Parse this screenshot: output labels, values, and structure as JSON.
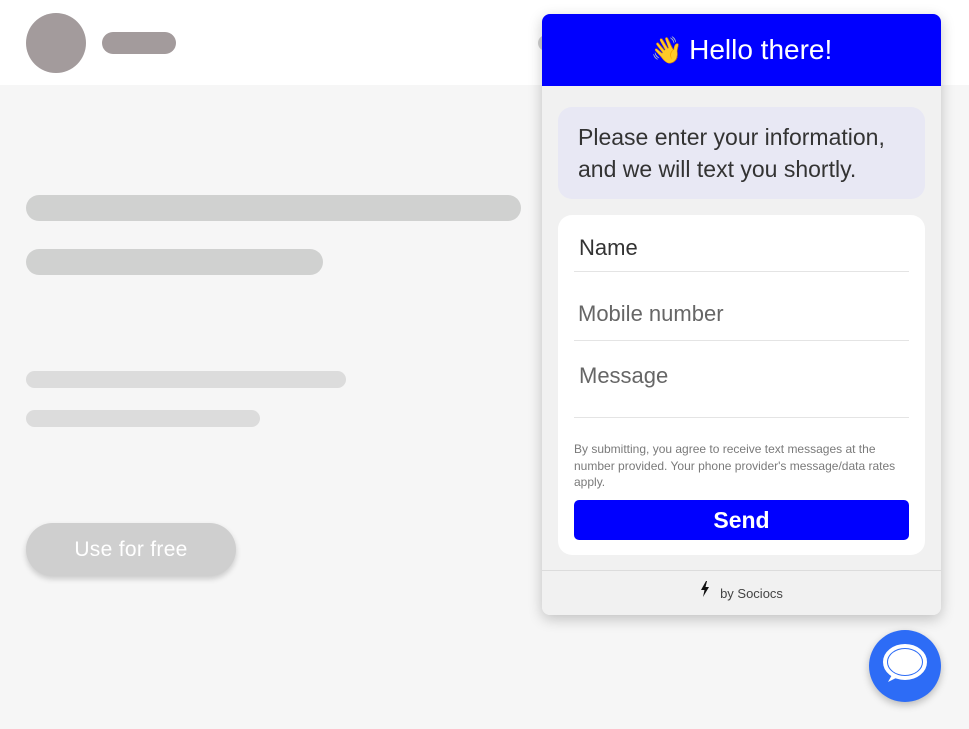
{
  "background_page": {
    "cta_label": "Use for free"
  },
  "widget": {
    "header_emoji": "👋",
    "header_title": "Hello there!",
    "intro_line1": "Please enter your information,",
    "intro_line2": "and we will text you shortly.",
    "form": {
      "name_placeholder": "Name",
      "mobile_placeholder": "Mobile number",
      "message_placeholder": "Message",
      "disclaimer": "By submitting, you agree to receive text messages at the number provided. Your phone provider's message/data rates apply.",
      "send_label": "Send"
    },
    "footer_text": "by Sociocs",
    "footer_icon": "lightning-bolt-icon"
  },
  "launcher_icon": "chat-bubble-icon",
  "colors": {
    "accent": "#0000ff",
    "launcher": "#2d6cf6"
  }
}
